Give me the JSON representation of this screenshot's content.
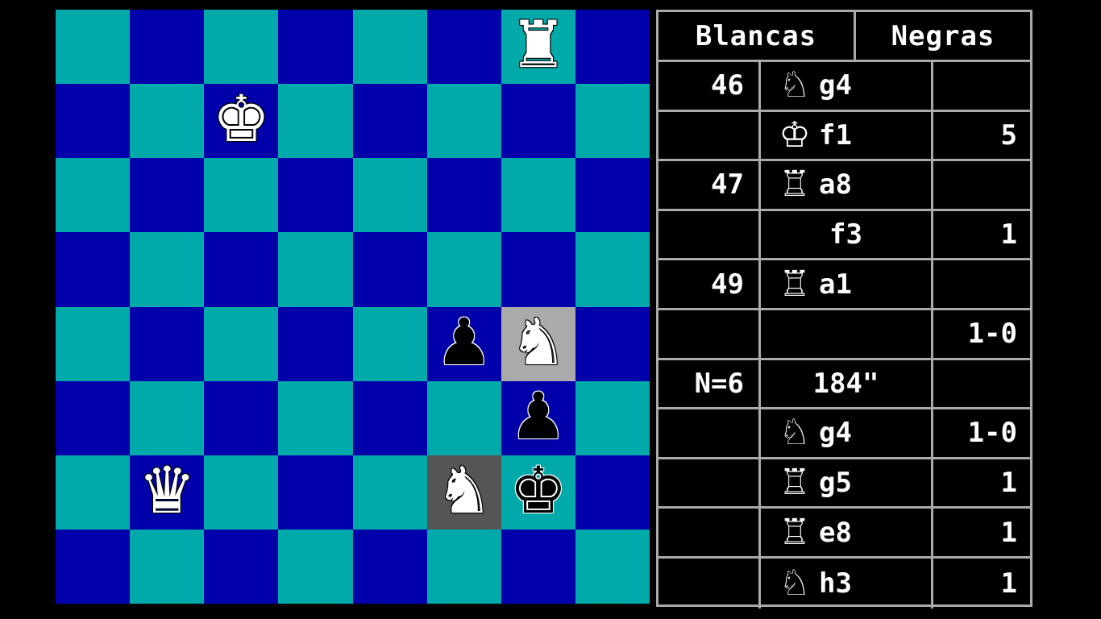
{
  "board": {
    "squares": [
      [
        "",
        "",
        "",
        "",
        "",
        "",
        "white-rook",
        ""
      ],
      [
        "",
        "",
        "white-king",
        "",
        "",
        "",
        "",
        ""
      ],
      [
        "",
        "",
        "",
        "",
        "",
        "",
        "",
        ""
      ],
      [
        "",
        "",
        "",
        "",
        "",
        "",
        "",
        ""
      ],
      [
        "",
        "",
        "",
        "",
        "",
        "black-pawn",
        "white-knight",
        ""
      ],
      [
        "",
        "",
        "",
        "",
        "",
        "",
        "black-pawn",
        ""
      ],
      [
        "",
        "white-queen",
        "",
        "",
        "",
        "white-knight",
        "black-king",
        ""
      ],
      [
        "",
        "",
        "",
        "",
        "",
        "",
        "",
        ""
      ]
    ],
    "highlights": [
      [
        4,
        6
      ],
      [
        6,
        5
      ]
    ],
    "colors": {
      "light": "#00aaaa",
      "dark": "#0000aa",
      "highlight_dark": "#555555",
      "highlight_light": "#aaaaaa"
    }
  },
  "glyphs": {
    "white-rook": "♜",
    "white-king": "♚",
    "white-queen": "♛",
    "white-knight": "♞",
    "black-pawn": "♟",
    "black-king": "♚",
    "rook": "♖",
    "king": "♔",
    "knight": "♘"
  },
  "panel": {
    "header_white": "Blancas",
    "header_black": "Negras",
    "rows": [
      {
        "num": "46",
        "piece": "knight",
        "square": "g4",
        "score": ""
      },
      {
        "num": "",
        "piece": "king",
        "square": "f1",
        "score": "5"
      },
      {
        "num": "47",
        "piece": "rook",
        "square": "a8",
        "score": ""
      },
      {
        "num": "",
        "piece": "",
        "square": "f3",
        "score": "1"
      },
      {
        "num": "49",
        "piece": "rook",
        "square": "a1",
        "score": ""
      },
      {
        "num": "",
        "piece": "",
        "square": "",
        "score": "1-0"
      },
      {
        "num": "N=6",
        "piece": "",
        "square": "184\"",
        "score": ""
      },
      {
        "num": "",
        "piece": "knight",
        "square": "g4",
        "score": "1-0"
      },
      {
        "num": "",
        "piece": "rook",
        "square": "g5",
        "score": "1"
      },
      {
        "num": "",
        "piece": "rook",
        "square": "e8",
        "score": "1"
      },
      {
        "num": "",
        "piece": "knight",
        "square": "h3",
        "score": "1"
      }
    ]
  }
}
